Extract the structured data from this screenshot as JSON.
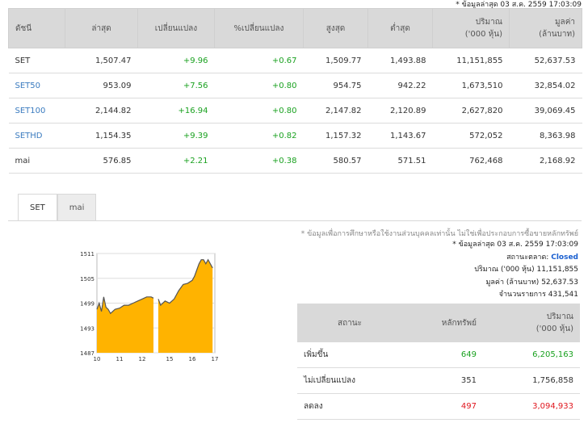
{
  "update_note": "* ข้อมูลล่าสุด 03 ส.ค. 2559 17:03:09",
  "index_table": {
    "headers": [
      "ดัชนี",
      "ล่าสุด",
      "เปลี่ยนแปลง",
      "%เปลี่ยนแปลง",
      "สูงสุด",
      "ต่ำสุด",
      "ปริมาณ\n('000 หุ้น)",
      "มูลค่า\n(ล้านบาท)"
    ],
    "rows": [
      {
        "name": "SET",
        "last": "1,507.47",
        "chg": "+9.96",
        "pct": "+0.67",
        "high": "1,509.77",
        "low": "1,493.88",
        "vol": "11,151,855",
        "val": "52,637.53"
      },
      {
        "name": "SET50",
        "last": "953.09",
        "chg": "+7.56",
        "pct": "+0.80",
        "high": "954.75",
        "low": "942.22",
        "vol": "1,673,510",
        "val": "32,854.02"
      },
      {
        "name": "SET100",
        "last": "2,144.82",
        "chg": "+16.94",
        "pct": "+0.80",
        "high": "2,147.82",
        "low": "2,120.89",
        "vol": "2,627,820",
        "val": "39,069.45"
      },
      {
        "name": "SETHD",
        "last": "1,154.35",
        "chg": "+9.39",
        "pct": "+0.82",
        "high": "1,157.32",
        "low": "1,143.67",
        "vol": "572,052",
        "val": "8,363.98"
      },
      {
        "name": "mai",
        "last": "576.85",
        "chg": "+2.21",
        "pct": "+0.38",
        "high": "580.57",
        "low": "571.51",
        "vol": "762,468",
        "val": "2,168.92"
      }
    ]
  },
  "tabs": [
    "SET",
    "mai"
  ],
  "disclaimer": "* ข้อมูลเพื่อการศึกษาหรือใช้งานส่วนบุคคลเท่านั้น ไม่ใช่เพื่อประกอบการซื้อขายหลักทรัพย์",
  "info": {
    "update": "* ข้อมูลล่าสุด 03 ส.ค. 2559 17:03:09",
    "market_status_label": "สถานะตลาด:",
    "market_status": "Closed",
    "volume_label": "ปริมาณ ('000 หุ้น)",
    "volume": "11,151,855",
    "value_label": "มูลค่า (ล้านบาท)",
    "value": "52,637.53",
    "trades_label": "จำนวนรายการ",
    "trades": "431,541"
  },
  "stat_table": {
    "headers": [
      "สถานะ",
      "หลักทรัพย์",
      "ปริมาณ\n('000 หุ้น)"
    ],
    "rows": [
      {
        "status": "เพิ่มขึ้น",
        "count": "649",
        "vol": "6,205,163",
        "color": "#19a11f"
      },
      {
        "status": "ไม่เปลี่ยนแปลง",
        "count": "351",
        "vol": "1,756,858",
        "color": "#333333"
      },
      {
        "status": "ลดลง",
        "count": "497",
        "vol": "3,094,933",
        "color": "#e0161e"
      }
    ]
  },
  "colors": {
    "area_fill": "#ffb300",
    "line": "#555555",
    "positive": "#19a11f",
    "negative": "#e0161e",
    "closed": "#1a5fd0"
  },
  "chart_data": {
    "type": "area",
    "x_ticks": [
      "10",
      "11",
      "12",
      "15",
      "16",
      "17"
    ],
    "y_ticks": [
      "1511",
      "1505",
      "1499",
      "1493",
      "1487"
    ],
    "ylim": [
      1487,
      1511
    ],
    "x": [
      10,
      10.1,
      10.2,
      10.3,
      10.4,
      10.5,
      10.6,
      10.8,
      11.0,
      11.2,
      11.4,
      11.6,
      11.8,
      12.0,
      12.2,
      12.4,
      12.5,
      14.5,
      14.6,
      14.8,
      15.0,
      15.2,
      15.4,
      15.6,
      15.8,
      16.0,
      16.1,
      16.2,
      16.3,
      16.4,
      16.5,
      16.6,
      16.7,
      16.8,
      16.9
    ],
    "values": [
      1497.5,
      1499.0,
      1497.0,
      1500.5,
      1498.0,
      1497.5,
      1496.5,
      1497.5,
      1497.8,
      1498.5,
      1498.5,
      1499.0,
      1499.5,
      1500.0,
      1500.5,
      1500.5,
      1500.2,
      1500.0,
      1498.5,
      1499.5,
      1499.0,
      1500.0,
      1502.0,
      1503.5,
      1503.8,
      1504.5,
      1505.5,
      1507.0,
      1508.5,
      1509.5,
      1509.5,
      1508.5,
      1509.5,
      1508.5,
      1507.5
    ],
    "gap": [
      12.5,
      14.5
    ]
  }
}
